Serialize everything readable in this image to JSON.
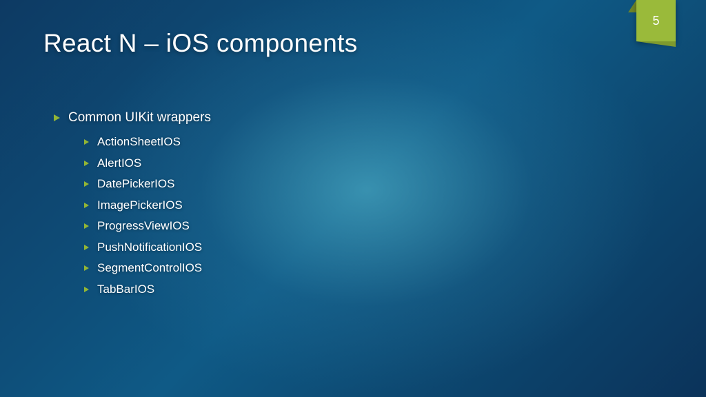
{
  "slide": {
    "title": "React N – iOS components",
    "page_number": "5"
  },
  "bullets": {
    "heading": "Common UIKit wrappers",
    "items": [
      "ActionSheetIOS",
      "AlertIOS",
      "DatePickerIOS",
      "ImagePickerIOS",
      "ProgressViewIOS",
      "PushNotificationIOS",
      "SegmentControlIOS",
      "TabBarIOS"
    ]
  },
  "colors": {
    "accent": "#9aba3a"
  }
}
